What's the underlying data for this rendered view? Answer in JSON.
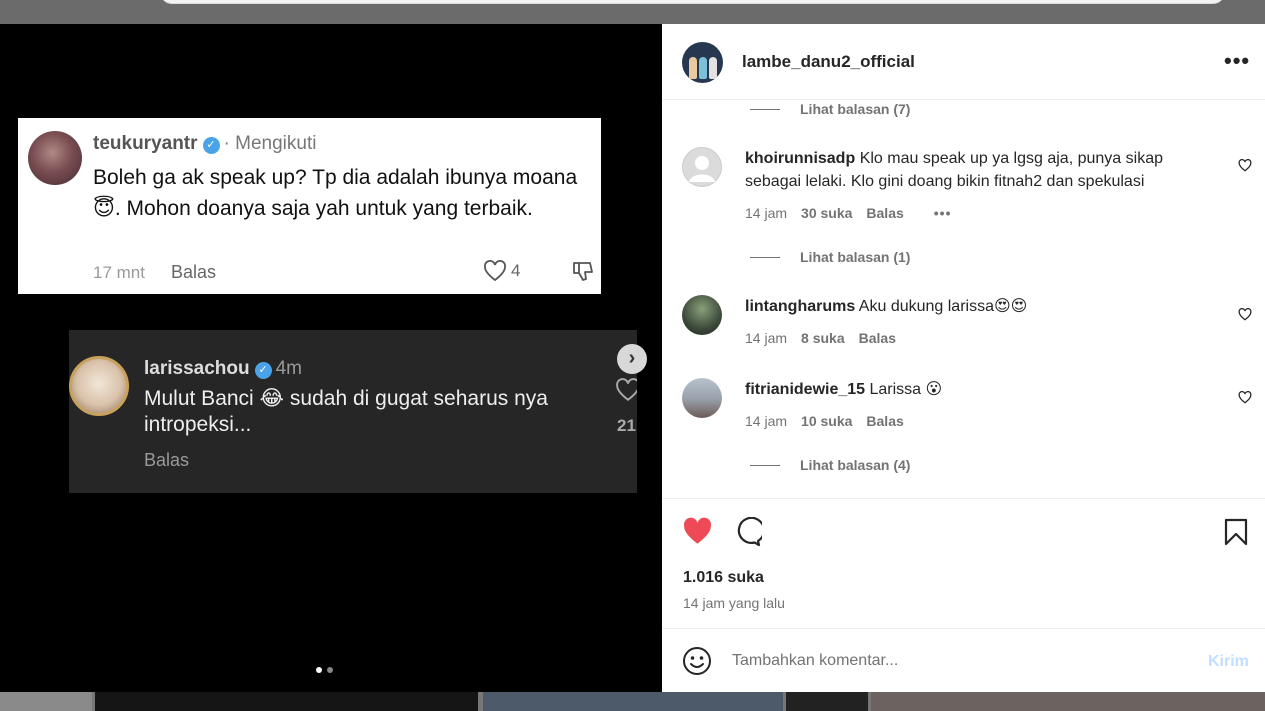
{
  "post": {
    "username": "lambe_danu2_official",
    "more_icon": "more-options-icon"
  },
  "media": {
    "card1": {
      "username": "teukuryantr",
      "follow_status": "· Mengikuti",
      "text": "Boleh ga ak speak up? Tp dia adalah ibunya moana😇. Mohon doanya saja yah untuk yang terbaik.",
      "time": "17 mnt",
      "reply": "Balas",
      "likes": "4"
    },
    "card2": {
      "username": "larissachou",
      "time": "4m",
      "text": "Mulut Banci 😂 sudah di gugat seharus nya intropeksi...",
      "reply": "Balas",
      "likes": "21"
    },
    "carousel": {
      "current": 1,
      "total": 2
    }
  },
  "comments": {
    "view_replies_top": "Lihat balasan (7)",
    "items": [
      {
        "username": "khoirunnisadp",
        "text": "Klo mau speak up ya lgsg aja, punya sikap sebagai lelaki. Klo gini doang bikin fitnah2 dan spekulasi",
        "time": "14 jam",
        "likes": "30 suka",
        "reply": "Balas",
        "more": "•••",
        "view_replies": "Lihat balasan (1)"
      },
      {
        "username": "lintangharums",
        "text": "Aku dukung larissa😍😍",
        "time": "14 jam",
        "likes": "8 suka",
        "reply": "Balas"
      },
      {
        "username": "fitrianidewie_15",
        "text": "Larissa 😮",
        "time": "14 jam",
        "likes": "10 suka",
        "reply": "Balas",
        "view_replies": "Lihat balasan (4)"
      }
    ]
  },
  "actions": {
    "like_count": "1.016 suka",
    "posted_ago": "14 jam yang lalu",
    "liked": true,
    "like_color": "#ed4956"
  },
  "add_comment": {
    "placeholder": "Tambahkan komentar...",
    "send_label": "Kirim"
  }
}
